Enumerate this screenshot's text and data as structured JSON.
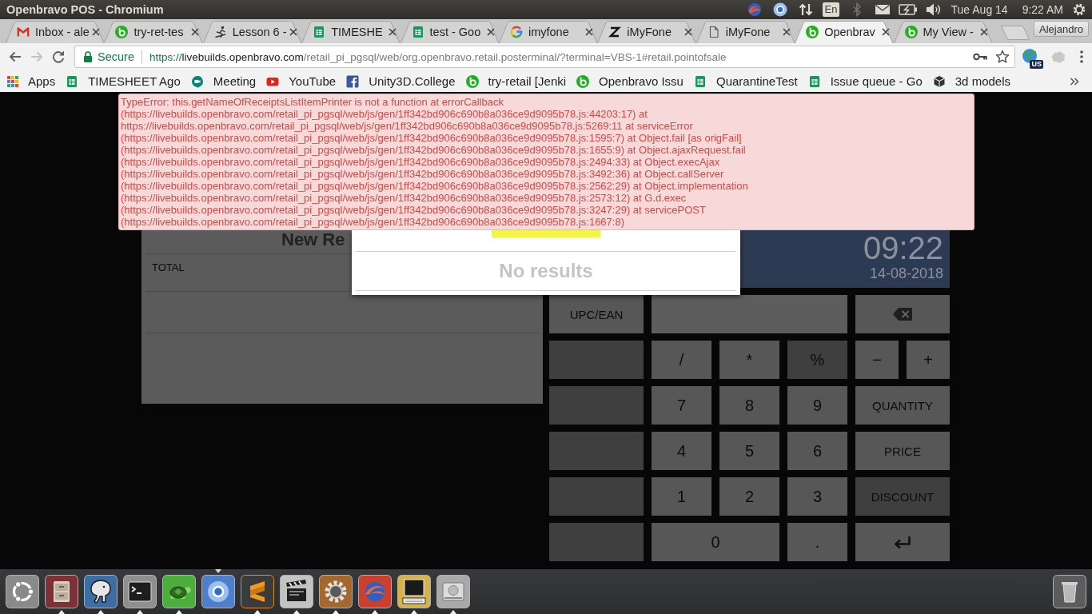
{
  "top_panel": {
    "title": "Openbravo POS - Chromium",
    "indicators": [
      {
        "kind": "swirl"
      },
      {
        "kind": "round"
      },
      {
        "kind": "transfer"
      },
      {
        "kind": "layout",
        "label": "En"
      },
      {
        "kind": "bluetooth"
      },
      {
        "kind": "mail"
      },
      {
        "kind": "battery"
      },
      {
        "kind": "volume"
      }
    ],
    "date": "Tue Aug 14",
    "time": "9:22 AM"
  },
  "tabs": [
    {
      "kind": "mail",
      "title": "Inbox - ale",
      "selected": false
    },
    {
      "kind": "bravo",
      "title": "try-ret-tes",
      "selected": false
    },
    {
      "kind": "skater",
      "title": "Lesson 6 -",
      "selected": false
    },
    {
      "kind": "sheet",
      "title": "TIMESHE",
      "selected": false
    },
    {
      "kind": "sheet",
      "title": "test - Goo",
      "selected": false
    },
    {
      "kind": "google",
      "title": "imyfone",
      "selected": false
    },
    {
      "kind": "letter",
      "title": "iMyFone",
      "selected": false
    },
    {
      "kind": "page",
      "title": "iMyFone",
      "selected": false
    },
    {
      "kind": "bravo",
      "title": "Openbrav",
      "selected": true
    },
    {
      "kind": "bravo",
      "title": "My View -",
      "selected": false
    }
  ],
  "profile": {
    "name": "Alejandro"
  },
  "toolbar": {
    "nav": [
      {
        "kind": "back",
        "disabled": false
      },
      {
        "kind": "forward",
        "disabled": true
      },
      {
        "kind": "reload",
        "disabled": false
      }
    ],
    "security": "Secure",
    "url": {
      "scheme": "https://",
      "host": "livebuilds.openbravo.com",
      "path": "/retail_pi_pgsql/web/org.openbravo.retail.posterminal/?terminal=VBS-1#retail.pointofsale"
    },
    "extension_badge": "US"
  },
  "bookmarks": [
    {
      "kind": "apps",
      "title": "Apps"
    },
    {
      "kind": "sheet",
      "title": "TIMESHEET Ago"
    },
    {
      "kind": "meet",
      "title": "Meeting"
    },
    {
      "kind": "video",
      "title": "YouTube"
    },
    {
      "kind": "social",
      "title": "Unity3D.College"
    },
    {
      "kind": "bravo",
      "title": "try-retail [Jenki"
    },
    {
      "kind": "bravo",
      "title": "Openbravo Issu"
    },
    {
      "kind": "sheet",
      "title": "QuarantineTest"
    },
    {
      "kind": "sheet",
      "title": "Issue queue - Go"
    },
    {
      "kind": "box",
      "title": "3d models"
    }
  ],
  "error": {
    "message": "TypeError: this.getNameOfReceiptsListItemPrinter is not a function at errorCallback (https://livebuilds.openbravo.com/retail_pi_pgsql/web/js/gen/1ff342bd906c690b8a036ce9d9095b78.js:44203:17) at https://livebuilds.openbravo.com/retail_pi_pgsql/web/js/gen/1ff342bd906c690b8a036ce9d9095b78.js:5269:11 at serviceError (https://livebuilds.openbravo.com/retail_pi_pgsql/web/js/gen/1ff342bd906c690b8a036ce9d9095b78.js:1595:7) at Object.fail [as origFail] (https://livebuilds.openbravo.com/retail_pi_pgsql/web/js/gen/1ff342bd906c690b8a036ce9d9095b78.js:1655:9) at Object.ajaxRequest.fail (https://livebuilds.openbravo.com/retail_pi_pgsql/web/js/gen/1ff342bd906c690b8a036ce9d9095b78.js:2494:33) at Object.execAjax (https://livebuilds.openbravo.com/retail_pi_pgsql/web/js/gen/1ff342bd906c690b8a036ce9d9095b78.js:3492:36) at Object.callServer (https://livebuilds.openbravo.com/retail_pi_pgsql/web/js/gen/1ff342bd906c690b8a036ce9d9095b78.js:2562:29) at Object.implementation (https://livebuilds.openbravo.com/retail_pi_pgsql/web/js/gen/1ff342bd906c690b8a036ce9d9095b78.js:2573:12) at G.d.exec (https://livebuilds.openbravo.com/retail_pi_pgsql/web/js/gen/1ff342bd906c690b8a036ce9d9095b78.js:3247:29) at servicePOST (https://livebuilds.openbravo.com/retail_pi_pgsql/web/js/gen/1ff342bd906c690b8a036ce9d9095b78.js:1667:8)"
  },
  "receipt": {
    "title": "New Re",
    "total_label": "TOTAL"
  },
  "search_popup": {
    "message": "No results"
  },
  "clock": {
    "time": "09:22",
    "date": "14-08-2018"
  },
  "keypad": {
    "rows": [
      [
        {
          "kind": "key",
          "label": "UPC/EAN",
          "disabled": false
        },
        {
          "kind": "field",
          "colspan": 3,
          "disabled": false
        },
        {
          "kind": "backspace",
          "colspan": 2,
          "disabled": false
        }
      ],
      [
        {
          "kind": "blank",
          "disabled": true
        },
        {
          "kind": "key",
          "label": "/",
          "disabled": false
        },
        {
          "kind": "key",
          "label": "*",
          "disabled": false
        },
        {
          "kind": "key",
          "label": "%",
          "disabled": true
        },
        {
          "kind": "key",
          "label": "−",
          "disabled": false
        },
        {
          "kind": "key",
          "label": "+",
          "disabled": false
        }
      ],
      [
        {
          "kind": "blank",
          "disabled": true
        },
        {
          "kind": "key",
          "label": "7",
          "disabled": false
        },
        {
          "kind": "key",
          "label": "8",
          "disabled": false
        },
        {
          "kind": "key",
          "label": "9",
          "disabled": false
        },
        {
          "kind": "key",
          "label": "QUANTITY",
          "colspan": 2,
          "disabled": false
        }
      ],
      [
        {
          "kind": "blank",
          "disabled": true
        },
        {
          "kind": "key",
          "label": "4",
          "disabled": false
        },
        {
          "kind": "key",
          "label": "5",
          "disabled": false
        },
        {
          "kind": "key",
          "label": "6",
          "disabled": false
        },
        {
          "kind": "key",
          "label": "PRICE",
          "colspan": 2,
          "disabled": false
        }
      ],
      [
        {
          "kind": "blank",
          "disabled": true
        },
        {
          "kind": "key",
          "label": "1",
          "disabled": false
        },
        {
          "kind": "key",
          "label": "2",
          "disabled": false
        },
        {
          "kind": "key",
          "label": "3",
          "disabled": false
        },
        {
          "kind": "key",
          "label": "DISCOUNT",
          "colspan": 2,
          "disabled": true
        }
      ],
      [
        {
          "kind": "blank",
          "disabled": true
        },
        {
          "kind": "key",
          "label": "0",
          "colspan": 2,
          "disabled": false
        },
        {
          "kind": "key",
          "label": ".",
          "disabled": false
        },
        {
          "kind": "enter",
          "colspan": 2,
          "disabled": false
        }
      ]
    ]
  },
  "launcher": [
    {
      "kind": "dash",
      "running": false,
      "focused": false
    },
    {
      "kind": "files",
      "running": true,
      "focused": false
    },
    {
      "kind": "database",
      "running": true,
      "focused": false
    },
    {
      "kind": "terminal",
      "running": true,
      "focused": false
    },
    {
      "kind": "turtle",
      "running": true,
      "focused": false
    },
    {
      "kind": "browser",
      "running": false,
      "focused": true
    },
    {
      "kind": "editor",
      "running": true,
      "focused": false
    },
    {
      "kind": "video",
      "running": true,
      "focused": false
    },
    {
      "kind": "ide",
      "running": true,
      "focused": false
    },
    {
      "kind": "globe",
      "running": true,
      "focused": false
    },
    {
      "kind": "xterm",
      "running": true,
      "focused": false
    },
    {
      "kind": "disk",
      "running": true,
      "focused": false
    }
  ]
}
